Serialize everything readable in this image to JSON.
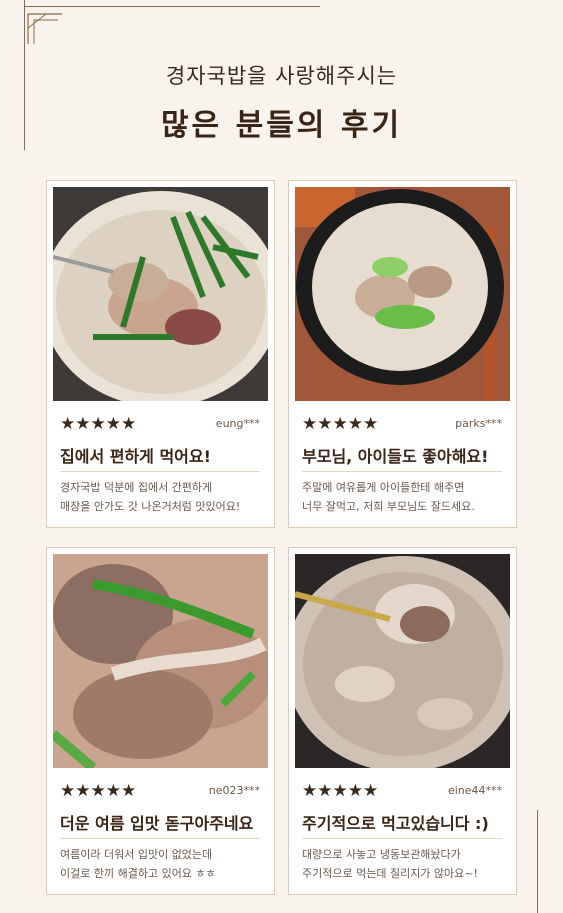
{
  "header": {
    "subtitle": "경자국밥을 사랑해주시는",
    "title": "많은 분들의 후기"
  },
  "colors": {
    "background": "#f8f3ed",
    "accent_brown": "#3a2416",
    "line": "#8a6a4a"
  },
  "reviews": [
    {
      "stars": "★★★★★",
      "rating": 5,
      "user": "eung***",
      "headline": "집에서 편하게 먹어요!",
      "body_lines": [
        "경자국밥 덕분에 집에서 간편하게",
        "매장을 안가도 갓 나온거처럼 맛있어요!"
      ],
      "photo_icon": "soup-bowl-with-chives-photo"
    },
    {
      "stars": "★★★★★",
      "rating": 5,
      "user": "parks***",
      "headline": "부모님, 아이들도 좋아해요!",
      "body_lines": [
        "주말에 여유롭게 아이들한테 해주면",
        "너무 잘먹고, 저희 부모님도 잘드세요."
      ],
      "photo_icon": "black-pot-soup-photo"
    },
    {
      "stars": "★★★★★",
      "rating": 5,
      "user": "ne023***",
      "headline": "더운 여름 입맛 돋구아주네요",
      "body_lines": [
        "여름이라 더워서 입맛이 없었는데",
        "이걸로 한끼 해결하고 있어요 ㅎㅎ"
      ],
      "photo_icon": "meat-closeup-photo"
    },
    {
      "stars": "★★★★★",
      "rating": 5,
      "user": "eine44***",
      "headline": "주기적으로 먹고있습니다 :)",
      "body_lines": [
        "대량으로 사놓고 냉동보관해놨다가",
        "주기적으로 먹는데 질리지가 않아요~!"
      ],
      "photo_icon": "spoon-in-soup-photo"
    }
  ]
}
